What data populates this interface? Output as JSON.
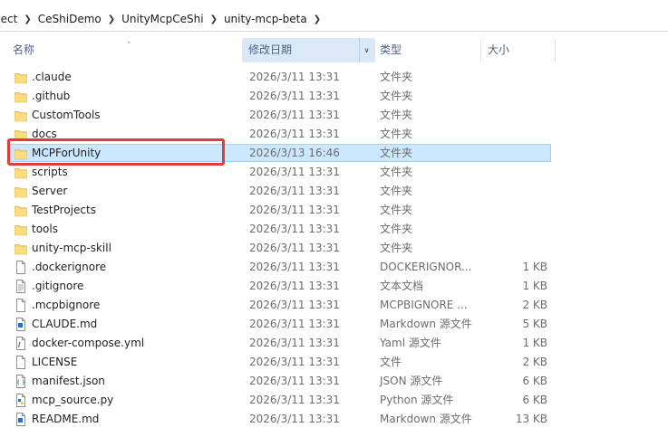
{
  "breadcrumb": [
    "oject",
    "CeShiDemo",
    "UnityMcpCeShi",
    "unity-mcp-beta"
  ],
  "columns": {
    "name": "名称",
    "date": "修改日期",
    "type": "类型",
    "size": "大小"
  },
  "files": [
    {
      "name": ".claude",
      "date": "2026/3/11 13:31",
      "type": "文件夹",
      "size": "",
      "icon": "folder-icon"
    },
    {
      "name": ".github",
      "date": "2026/3/11 13:31",
      "type": "文件夹",
      "size": "",
      "icon": "folder-icon"
    },
    {
      "name": "CustomTools",
      "date": "2026/3/11 13:31",
      "type": "文件夹",
      "size": "",
      "icon": "folder-icon"
    },
    {
      "name": "docs",
      "date": "2026/3/11 13:31",
      "type": "文件夹",
      "size": "",
      "icon": "folder-icon"
    },
    {
      "name": "MCPForUnity",
      "date": "2026/3/13 16:46",
      "type": "文件夹",
      "size": "",
      "icon": "folder-icon",
      "selected": true
    },
    {
      "name": "scripts",
      "date": "2026/3/11 13:31",
      "type": "文件夹",
      "size": "",
      "icon": "folder-icon"
    },
    {
      "name": "Server",
      "date": "2026/3/11 13:31",
      "type": "文件夹",
      "size": "",
      "icon": "folder-icon"
    },
    {
      "name": "TestProjects",
      "date": "2026/3/11 13:31",
      "type": "文件夹",
      "size": "",
      "icon": "folder-icon"
    },
    {
      "name": "tools",
      "date": "2026/3/11 13:31",
      "type": "文件夹",
      "size": "",
      "icon": "folder-icon"
    },
    {
      "name": "unity-mcp-skill",
      "date": "2026/3/11 13:31",
      "type": "文件夹",
      "size": "",
      "icon": "folder-icon"
    },
    {
      "name": ".dockerignore",
      "date": "2026/3/11 13:31",
      "type": "DOCKERIGNOR...",
      "size": "1 KB",
      "icon": "file-icon"
    },
    {
      "name": ".gitignore",
      "date": "2026/3/11 13:31",
      "type": "文本文档",
      "size": "1 KB",
      "icon": "text-file-icon"
    },
    {
      "name": ".mcpbignore",
      "date": "2026/3/11 13:31",
      "type": "MCPBIGNORE ...",
      "size": "2 KB",
      "icon": "file-icon"
    },
    {
      "name": "CLAUDE.md",
      "date": "2026/3/11 13:31",
      "type": "Markdown 源文件",
      "size": "5 KB",
      "icon": "markdown-file-icon"
    },
    {
      "name": "docker-compose.yml",
      "date": "2026/3/11 13:31",
      "type": "Yaml 源文件",
      "size": "1 KB",
      "icon": "yaml-file-icon"
    },
    {
      "name": "LICENSE",
      "date": "2026/3/11 13:31",
      "type": "文件",
      "size": "2 KB",
      "icon": "file-icon"
    },
    {
      "name": "manifest.json",
      "date": "2026/3/11 13:31",
      "type": "JSON 源文件",
      "size": "6 KB",
      "icon": "json-file-icon"
    },
    {
      "name": "mcp_source.py",
      "date": "2026/3/11 13:31",
      "type": "Python 源文件",
      "size": "6 KB",
      "icon": "python-file-icon"
    },
    {
      "name": "README.md",
      "date": "2026/3/11 13:31",
      "type": "Markdown 源文件",
      "size": "13 KB",
      "icon": "markdown-file-icon"
    }
  ],
  "colors": {
    "selection": "#cce8ff",
    "highlight": "#e33b3b",
    "folder": "#f8d775"
  }
}
